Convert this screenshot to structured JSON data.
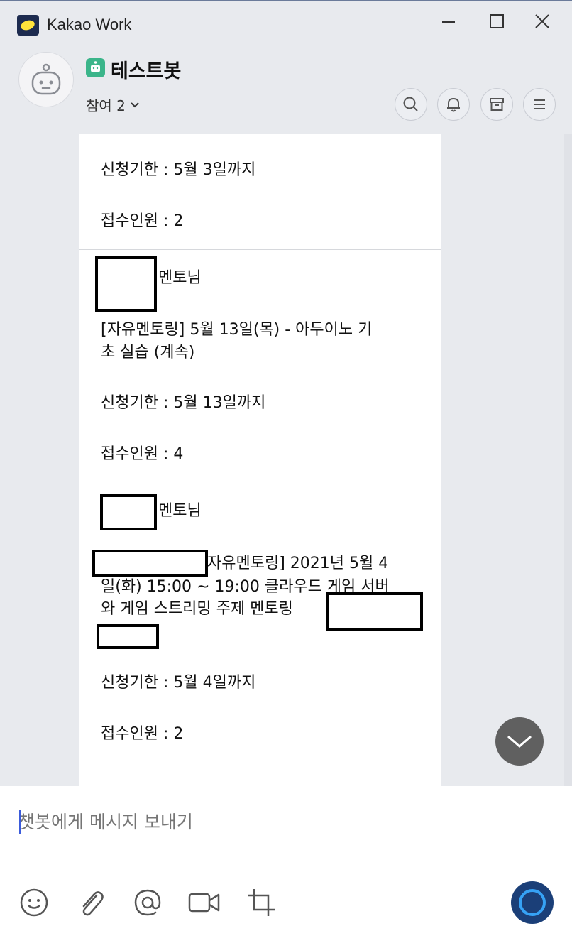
{
  "window": {
    "app_title": "Kakao Work",
    "controls": [
      "minimize-icon",
      "maximize-icon",
      "close-icon"
    ]
  },
  "header": {
    "chat_name": "테스트봇",
    "participants": "참여 2",
    "actions": [
      "search-icon",
      "bell-icon",
      "archive-icon",
      "menu-icon"
    ]
  },
  "messages": [
    {
      "deadline": "신청기한 : 5월 3일까지",
      "count": "접수인원 : 2"
    },
    {
      "mentor_suffix": "멘토님",
      "title_line1": "[자유멘토링] 5월 13일(목) - 아두이노 기",
      "title_line2": "초 실습 (계속)",
      "deadline": "신청기한 : 5월 13일까지",
      "count": "접수인원 : 4"
    },
    {
      "mentor_suffix": "멘토님",
      "title_line1": "자유멘토링] 2021년 5월 4",
      "title_line2": "일(화) 15:00 ~ 19:00 클라우드 게임 서버",
      "title_line3": "와 게임 스트리밍 주제 멘토링",
      "deadline": "신청기한 : 5월 4일까지",
      "count": "접수인원 : 2"
    }
  ],
  "input": {
    "placeholder": "챗봇에게 메시지 보내기"
  },
  "toolbar": [
    "emoji-icon",
    "attachment-icon",
    "mention-icon",
    "video-icon",
    "crop-icon"
  ],
  "colors": {
    "background": "#e8eaee",
    "bot_badge": "#3bb58a",
    "logo_bg": "#1d2b4f",
    "logo_yellow": "#ffe33b",
    "send_button": "#1b3f78",
    "send_ring": "#36a2f5",
    "scroll_button": "#606060"
  }
}
